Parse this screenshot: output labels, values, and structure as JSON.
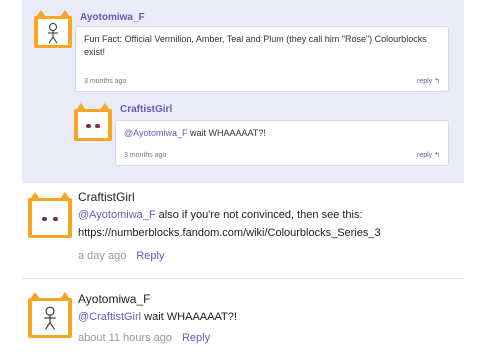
{
  "comments": [
    {
      "username": "Ayotomiwa_F",
      "text": "Fun Fact: Official Vermilion, Amber, Teal and Plum (they call him \"Rose\") Colourblocks exist!",
      "time": "3 months ago",
      "reply_label": "reply"
    },
    {
      "username": "CraftistGirl",
      "mention": "@Ayotomiwa_F",
      "text": " wait WHAAAAAT?!",
      "time": "3 months ago",
      "reply_label": "reply"
    },
    {
      "username": "CraftistGirl",
      "mention": "@Ayotomiwa_F",
      "text_line1": " also if you're not convinced, then see this:",
      "text_line2": "https://numberblocks.fandom.com/wiki/Colourblocks_Series_3",
      "time": "a day ago",
      "reply_label": "Reply"
    },
    {
      "username": "Ayotomiwa_F",
      "mention": "@CraftistGirl",
      "text": " wait WHAAAAAT?!",
      "time": "about 11 hours ago",
      "reply_label": "Reply"
    }
  ],
  "colors": {
    "accent": "#6b5bb5",
    "avatar_frame": "#f5a623",
    "thread_bg": "#e9ebf7"
  },
  "icons": {
    "reply": "reply-arrow-icon"
  }
}
